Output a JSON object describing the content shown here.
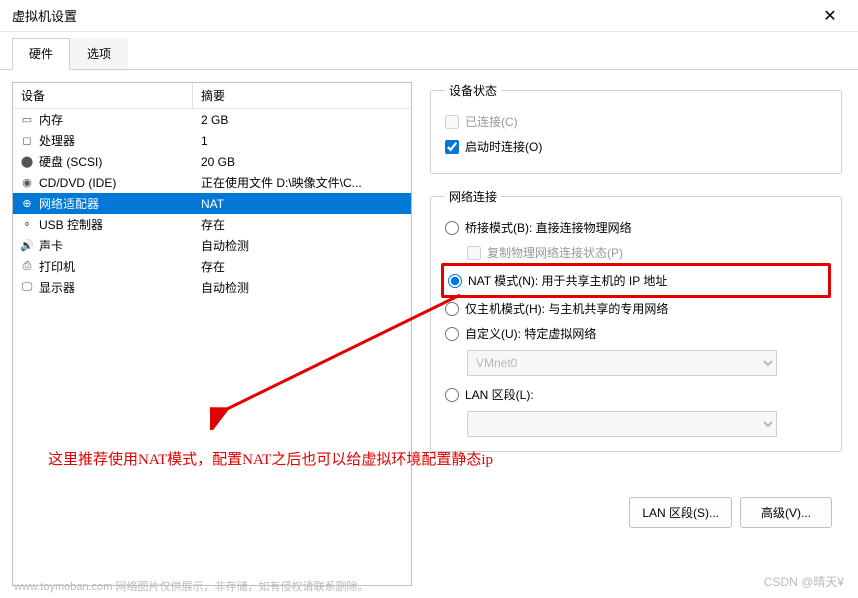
{
  "window": {
    "title": "虚拟机设置"
  },
  "tabs": {
    "hardware": "硬件",
    "options": "选项"
  },
  "list_header": {
    "device": "设备",
    "summary": "摘要"
  },
  "devices": [
    {
      "icon": "memory-icon",
      "name": "内存",
      "summary": "2 GB"
    },
    {
      "icon": "cpu-icon",
      "name": "处理器",
      "summary": "1"
    },
    {
      "icon": "disk-icon",
      "name": "硬盘 (SCSI)",
      "summary": "20 GB"
    },
    {
      "icon": "cd-icon",
      "name": "CD/DVD (IDE)",
      "summary": "正在使用文件 D:\\映像文件\\C..."
    },
    {
      "icon": "network-icon",
      "name": "网络适配器",
      "summary": "NAT"
    },
    {
      "icon": "usb-icon",
      "name": "USB 控制器",
      "summary": "存在"
    },
    {
      "icon": "sound-icon",
      "name": "声卡",
      "summary": "自动检测"
    },
    {
      "icon": "printer-icon",
      "name": "打印机",
      "summary": "存在"
    },
    {
      "icon": "display-icon",
      "name": "显示器",
      "summary": "自动检测"
    }
  ],
  "device_status": {
    "legend": "设备状态",
    "connected": "已连接(C)",
    "connect_at_power": "启动时连接(O)"
  },
  "network_connection": {
    "legend": "网络连接",
    "bridged": "桥接模式(B): 直接连接物理网络",
    "replicate": "复制物理网络连接状态(P)",
    "nat": "NAT 模式(N): 用于共享主机的 IP 地址",
    "host_only": "仅主机模式(H): 与主机共享的专用网络",
    "custom": "自定义(U): 特定虚拟网络",
    "custom_value": "VMnet0",
    "lan_segment": "LAN 区段(L):",
    "lan_value": ""
  },
  "buttons": {
    "lan_segments": "LAN 区段(S)...",
    "advanced": "高级(V)..."
  },
  "annotation": "这里推荐使用NAT模式，配置NAT之后也可以给虚拟环境配置静态ip",
  "watermark_left": "www.toymoban.com 网络图片仅供展示，非存储，如有侵权请联系删除。",
  "watermark_right": "CSDN @晴天¥"
}
